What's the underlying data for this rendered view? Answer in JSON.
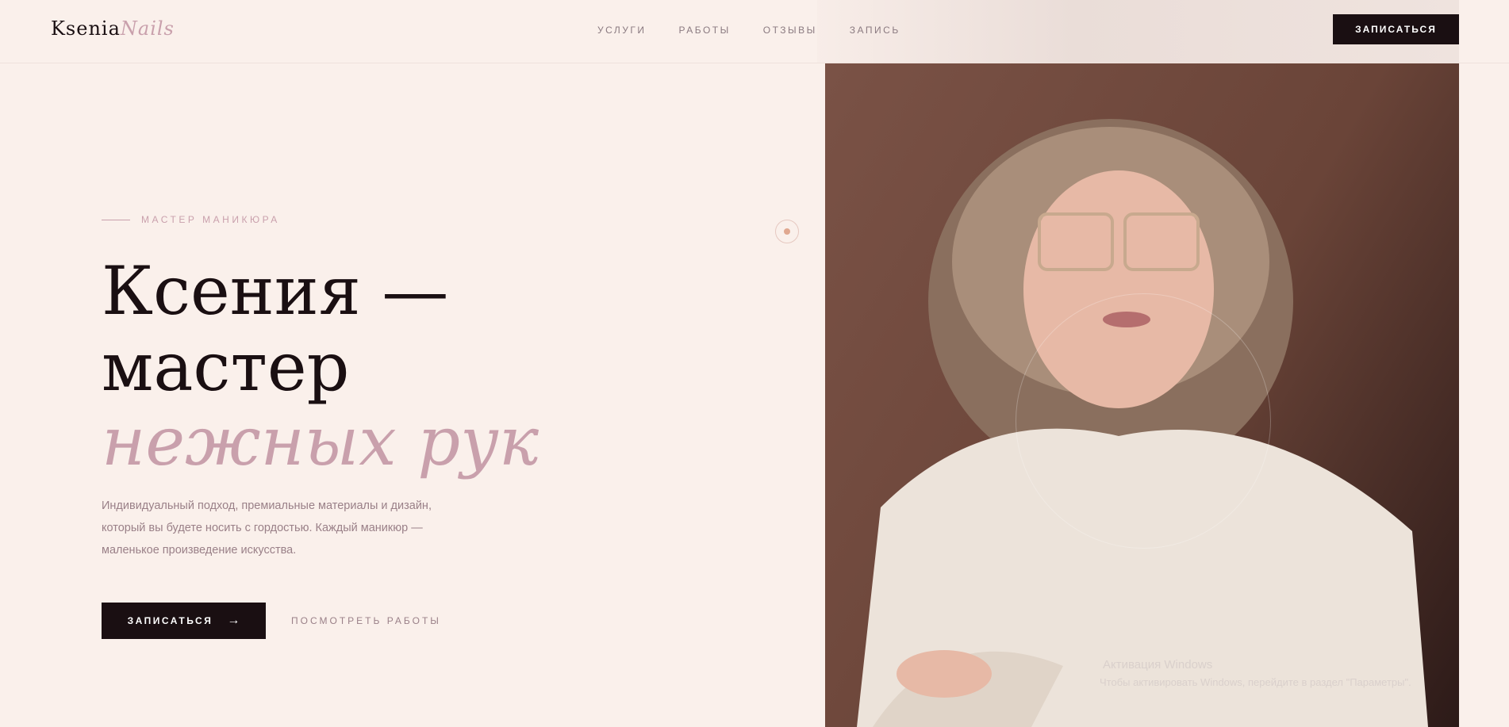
{
  "header": {
    "logo_main": "Ksenia",
    "logo_accent": "Nails",
    "nav": [
      {
        "label": "УСЛУГИ"
      },
      {
        "label": "РАБОТЫ"
      },
      {
        "label": "ОТЗЫВЫ"
      },
      {
        "label": "ЗАПИСЬ"
      }
    ],
    "cta_label": "ЗАПИСАТЬСЯ"
  },
  "hero": {
    "eyebrow": "МАСТЕР МАНИКЮРА",
    "title_line1": "Ксения —",
    "title_line2": "мастер",
    "title_line3": "нежных рук",
    "lead": "Индивидуальный подход, премиальные материалы и дизайн, который вы будете носить с гордостью. Каждый маникюр — маленькое произведение искусства.",
    "cta_label": "ЗАПИСАТЬСЯ",
    "cta_arrow": "→",
    "secondary_label": "ПОСМОТРЕТЬ РАБОТЫ"
  },
  "watermark": {
    "line1": "Активация Windows",
    "line2": "Чтобы активировать Windows, перейдите в раздел \"Параметры\"."
  },
  "colors": {
    "background": "#faf0eb",
    "ink": "#1a0f12",
    "accent": "#c9a0ac"
  }
}
